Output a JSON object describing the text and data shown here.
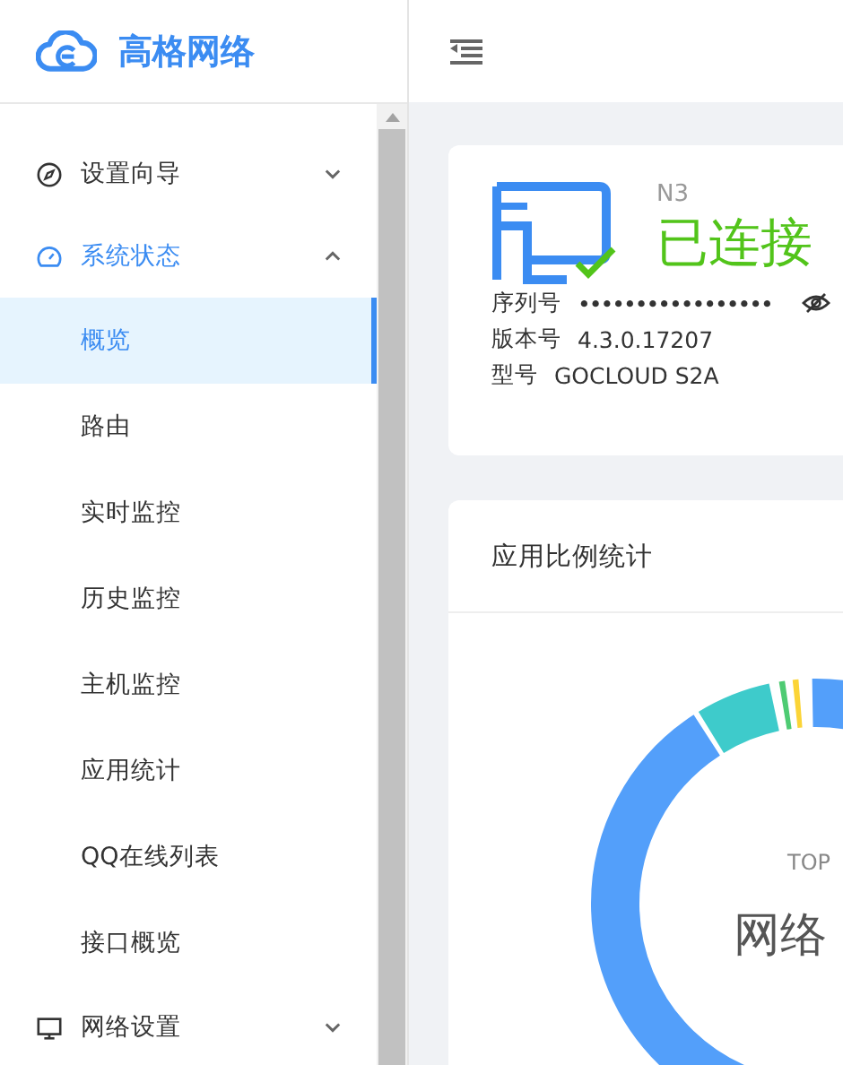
{
  "brand": {
    "name": "高格网络"
  },
  "sidebar": {
    "items": [
      {
        "label": "设置向导",
        "kind": "compass",
        "expanded": false,
        "active": false
      },
      {
        "label": "系统状态",
        "kind": "gauge",
        "expanded": true,
        "active": true,
        "children": [
          {
            "label": "概览",
            "selected": true
          },
          {
            "label": "路由",
            "selected": false
          },
          {
            "label": "实时监控",
            "selected": false
          },
          {
            "label": "历史监控",
            "selected": false
          },
          {
            "label": "主机监控",
            "selected": false
          },
          {
            "label": "应用统计",
            "selected": false
          },
          {
            "label": "QQ在线列表",
            "selected": false
          },
          {
            "label": "接口概览",
            "selected": false
          }
        ]
      },
      {
        "label": "网络设置",
        "kind": "monitor",
        "expanded": false,
        "active": false
      }
    ]
  },
  "device": {
    "model_code": "N3",
    "status": "已连接",
    "connected": true,
    "fields": [
      {
        "label": "序列号",
        "value": "•••••••••••••••••",
        "kind": "secret"
      },
      {
        "label": "版本号",
        "value": "4.3.0.17207",
        "kind": "text"
      },
      {
        "label": "型号",
        "value": "GOCLOUD S2A",
        "kind": "text"
      }
    ]
  },
  "app_stats": {
    "title": "应用比例统计",
    "center_caption": "TOP",
    "center_label": "网络"
  }
}
